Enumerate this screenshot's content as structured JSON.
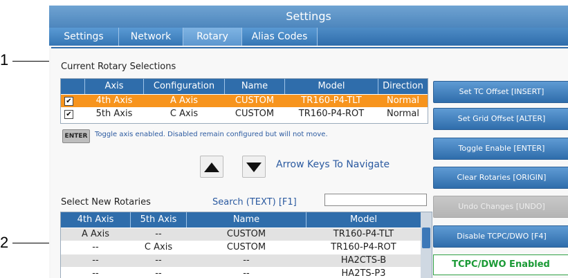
{
  "callouts": {
    "one": "1",
    "two": "2"
  },
  "window": {
    "title": "Settings"
  },
  "tabs": [
    "Settings",
    "Network",
    "Rotary",
    "Alias Codes"
  ],
  "current": {
    "heading": "Current Rotary Selections",
    "columns": [
      "Axis",
      "Configuration",
      "Name",
      "Model",
      "Direction"
    ],
    "rows": [
      {
        "checked": true,
        "axis": "4th Axis",
        "configuration": "A Axis",
        "name": "CUSTOM",
        "model": "TR160-P4-TLT",
        "direction": "Normal"
      },
      {
        "checked": true,
        "axis": "5th Axis",
        "configuration": "C Axis",
        "name": "CUSTOM",
        "model": "TR160-P4-ROT",
        "direction": "Normal"
      }
    ]
  },
  "hint": {
    "key": "ENTER",
    "text": "Toggle axis enabled. Disabled remain configured but will not move."
  },
  "nav": {
    "text": "Arrow Keys To Navigate"
  },
  "select": {
    "heading": "Select New Rotaries",
    "search_label": "Search (TEXT) [F1]",
    "search_value": "",
    "columns": [
      "4th Axis",
      "5th Axis",
      "Name",
      "Model"
    ],
    "rows": [
      {
        "a4": "A Axis",
        "a5": "--",
        "name": "CUSTOM",
        "model": "TR160-P4-TLT"
      },
      {
        "a4": "--",
        "a5": "C Axis",
        "name": "CUSTOM",
        "model": "TR160-P4-ROT"
      },
      {
        "a4": "--",
        "a5": "--",
        "name": "--",
        "model": "HA2CTS-B"
      },
      {
        "a4": "--",
        "a5": "--",
        "name": "--",
        "model": "HA2TS-P3"
      }
    ]
  },
  "buttons": {
    "set_tc": "Set TC Offset [INSERT]",
    "set_grid": "Set Grid Offset [ALTER]",
    "toggle": "Toggle Enable  [ENTER]",
    "clear": "Clear Rotaries [ORIGIN]",
    "undo": "Undo Changes [UNDO]",
    "disable_tcpc": "Disable TCPC/DWO [F4]"
  },
  "status": {
    "tcpc": "TCPC/DWO Enabled"
  },
  "colors": {
    "selected_row": "#f7941d",
    "header_blue": "#2f6dab",
    "status_green": "#1a9a35"
  },
  "icons": {
    "up": "up-arrow-icon",
    "down": "down-arrow-icon",
    "check": "checkmark-icon"
  }
}
